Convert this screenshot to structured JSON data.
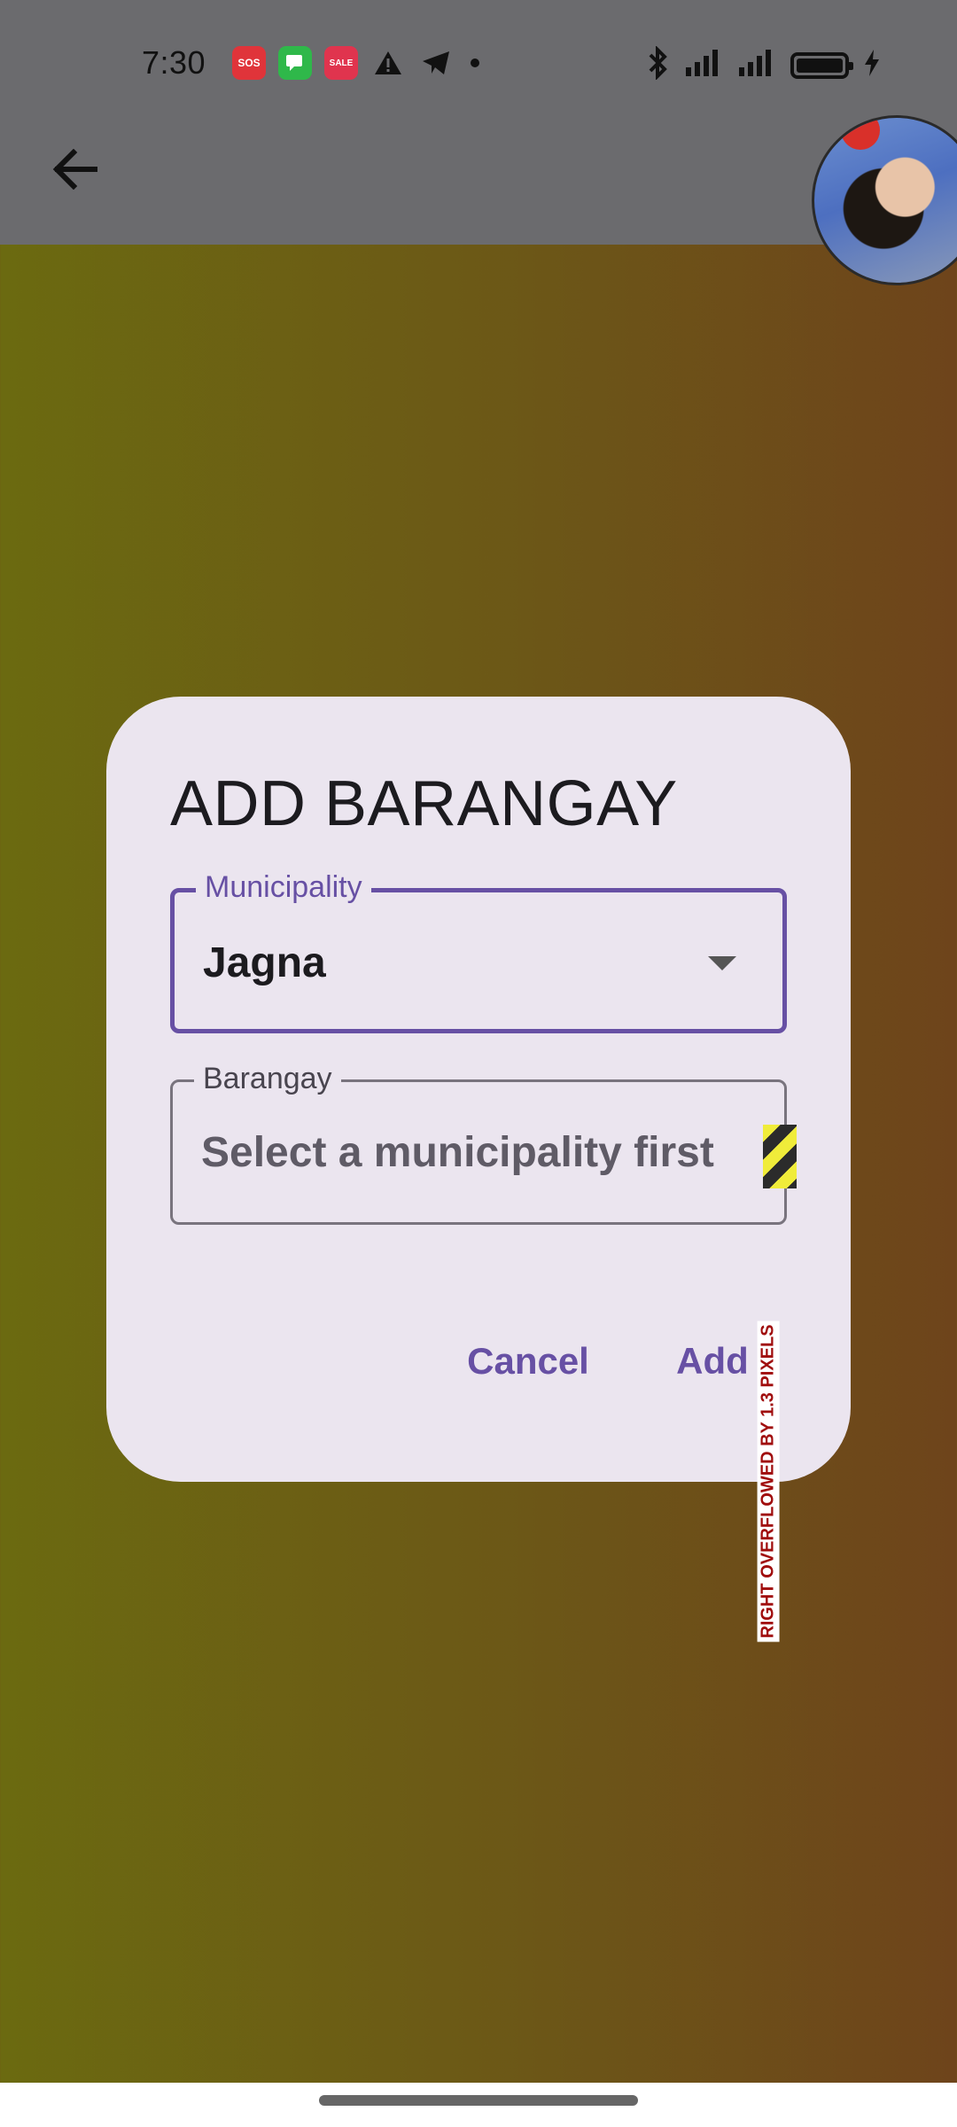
{
  "status_bar": {
    "time": "7:30",
    "notification_icons": [
      "sos-icon",
      "messages-icon",
      "sale-shop-icon",
      "warning-icon",
      "telegram-icon",
      "dot-icon"
    ],
    "sos_label": "SOS",
    "sale_label": "SALE",
    "system_icons": [
      "bluetooth-icon",
      "signal-icon",
      "signal-icon",
      "battery-icon",
      "charging-icon"
    ]
  },
  "app_bar": {
    "back_icon": "arrow-back-icon",
    "avatar": "profile-avatar"
  },
  "dialog": {
    "title": "ADD BARANGAY",
    "municipality": {
      "label": "Municipality",
      "value": "Jagna"
    },
    "barangay": {
      "label": "Barangay",
      "placeholder": "Select a municipality first"
    },
    "overflow_warning": "RIGHT OVERFLOWED BY 1.3 PIXELS",
    "cancel_label": "Cancel",
    "add_label": "Add"
  },
  "colors": {
    "primary": "#6750a4",
    "dialog_bg": "#ebe5ef",
    "outline": "#79747e"
  }
}
